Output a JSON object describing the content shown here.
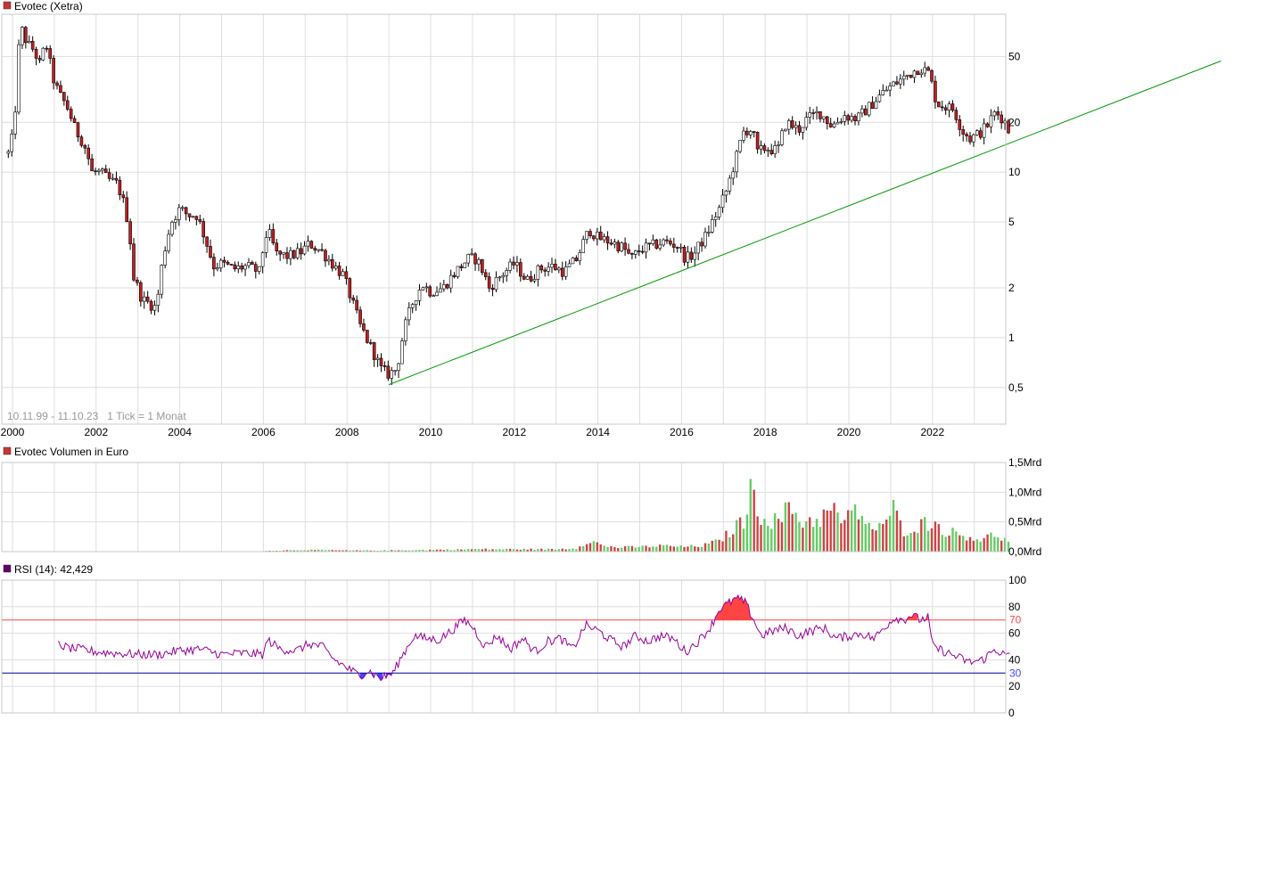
{
  "colors": {
    "up": "#00a000",
    "down": "#a00000",
    "up_body": "#ffffff",
    "down_body": "#c02020",
    "trendline": "#009900",
    "vol_up": "#66cc66",
    "vol_down": "#cc4444",
    "rsi_line": "#990099",
    "rsi_over": "#ff4444",
    "rsi_under": "#4444ff",
    "legend_price": "#cc3333",
    "legend_volume": "#cc3333",
    "legend_rsi": "#660066"
  },
  "chart_data": [
    {
      "type": "candlestick",
      "title": "Evotec (Xetra)",
      "subtitle": "10.11.99 - 11.10.23   1 Tick = 1 Monat",
      "scale": "log",
      "x_tick_labels": [
        "2000",
        "2002",
        "2004",
        "2006",
        "2008",
        "2010",
        "2012",
        "2014",
        "2016",
        "2018",
        "2020",
        "2022"
      ],
      "y_tick_labels": [
        "50",
        "20",
        "10",
        "5",
        "2",
        "1",
        "0,5"
      ],
      "y_ticks": [
        50,
        20,
        10,
        5,
        2,
        1,
        0.5
      ],
      "ylim": [
        0.3,
        90
      ],
      "x_range": [
        1999.9,
        2023.85
      ],
      "anchors": [
        [
          1999.9,
          13
        ],
        [
          2000.05,
          18
        ],
        [
          2000.2,
          75
        ],
        [
          2000.35,
          60
        ],
        [
          2000.5,
          55
        ],
        [
          2000.65,
          45
        ],
        [
          2000.8,
          60
        ],
        [
          2000.95,
          38
        ],
        [
          2001.1,
          30
        ],
        [
          2001.3,
          25
        ],
        [
          2001.5,
          18
        ],
        [
          2001.7,
          15
        ],
        [
          2001.9,
          10
        ],
        [
          2002.1,
          10
        ],
        [
          2002.3,
          9
        ],
        [
          2002.5,
          8.5
        ],
        [
          2002.7,
          6
        ],
        [
          2002.9,
          2.3
        ],
        [
          2003.1,
          1.7
        ],
        [
          2003.3,
          1.6
        ],
        [
          2003.45,
          1.5
        ],
        [
          2003.6,
          3
        ],
        [
          2003.8,
          5
        ],
        [
          2004.0,
          6
        ],
        [
          2004.2,
          5.5
        ],
        [
          2004.4,
          5.5
        ],
        [
          2004.6,
          4
        ],
        [
          2004.8,
          2.7
        ],
        [
          2005.0,
          2.8
        ],
        [
          2005.3,
          2.6
        ],
        [
          2005.6,
          2.7
        ],
        [
          2005.9,
          2.5
        ],
        [
          2006.1,
          4.5
        ],
        [
          2006.3,
          3.2
        ],
        [
          2006.6,
          3.1
        ],
        [
          2006.9,
          3.3
        ],
        [
          2007.1,
          3.7
        ],
        [
          2007.4,
          3.3
        ],
        [
          2007.7,
          2.7
        ],
        [
          2007.9,
          2.4
        ],
        [
          2008.1,
          1.7
        ],
        [
          2008.3,
          1.2
        ],
        [
          2008.5,
          0.95
        ],
        [
          2008.8,
          0.65
        ],
        [
          2009.0,
          0.6
        ],
        [
          2009.2,
          0.65
        ],
        [
          2009.4,
          1.2
        ],
        [
          2009.6,
          1.7
        ],
        [
          2009.8,
          2.1
        ],
        [
          2010.0,
          1.9
        ],
        [
          2010.3,
          2.0
        ],
        [
          2010.6,
          2.5
        ],
        [
          2010.9,
          3.0
        ],
        [
          2011.1,
          3.0
        ],
        [
          2011.4,
          2.0
        ],
        [
          2011.7,
          2.4
        ],
        [
          2012.0,
          2.8
        ],
        [
          2012.3,
          2.2
        ],
        [
          2012.6,
          2.6
        ],
        [
          2012.9,
          2.7
        ],
        [
          2013.2,
          2.5
        ],
        [
          2013.5,
          3.0
        ],
        [
          2013.8,
          4.5
        ],
        [
          2014.0,
          4.0
        ],
        [
          2014.3,
          3.8
        ],
        [
          2014.6,
          3.5
        ],
        [
          2014.8,
          3.0
        ],
        [
          2015.0,
          3.4
        ],
        [
          2015.3,
          3.6
        ],
        [
          2015.6,
          3.8
        ],
        [
          2015.9,
          3.6
        ],
        [
          2016.1,
          3.0
        ],
        [
          2016.3,
          3.2
        ],
        [
          2016.6,
          4.2
        ],
        [
          2016.9,
          6.0
        ],
        [
          2017.1,
          8.0
        ],
        [
          2017.3,
          12
        ],
        [
          2017.5,
          18
        ],
        [
          2017.7,
          18
        ],
        [
          2017.8,
          13
        ],
        [
          2018.0,
          14
        ],
        [
          2018.3,
          13.5
        ],
        [
          2018.5,
          20
        ],
        [
          2018.8,
          18
        ],
        [
          2019.0,
          21
        ],
        [
          2019.3,
          23
        ],
        [
          2019.6,
          19
        ],
        [
          2019.9,
          22
        ],
        [
          2020.2,
          21
        ],
        [
          2020.5,
          25
        ],
        [
          2020.8,
          30
        ],
        [
          2021.0,
          33
        ],
        [
          2021.3,
          37
        ],
        [
          2021.5,
          40
        ],
        [
          2021.7,
          43
        ],
        [
          2021.9,
          40
        ],
        [
          2022.1,
          26
        ],
        [
          2022.3,
          25
        ],
        [
          2022.5,
          24
        ],
        [
          2022.7,
          18
        ],
        [
          2022.9,
          16
        ],
        [
          2023.1,
          17
        ],
        [
          2023.3,
          19
        ],
        [
          2023.5,
          23
        ],
        [
          2023.7,
          21
        ],
        [
          2023.85,
          17
        ]
      ],
      "trendline": [
        [
          2009.0,
          0.52
        ],
        [
          2028.9,
          47
        ]
      ]
    },
    {
      "type": "bar",
      "title": "Evotec Volumen in Euro",
      "y_tick_labels": [
        "1,5Mrd",
        "1,0Mrd",
        "0,5Mrd",
        "0,0Mrd"
      ],
      "y_ticks": [
        1.5,
        1.0,
        0.5,
        0.0
      ],
      "ylim": [
        0,
        1.5
      ],
      "unit": "Mrd EUR",
      "data_start": 2005.9,
      "anchors": [
        [
          2005.9,
          0.01
        ],
        [
          2007.0,
          0.03
        ],
        [
          2008.0,
          0.02
        ],
        [
          2009.0,
          0.02
        ],
        [
          2010.0,
          0.03
        ],
        [
          2011.0,
          0.04
        ],
        [
          2012.0,
          0.04
        ],
        [
          2013.0,
          0.04
        ],
        [
          2013.5,
          0.06
        ],
        [
          2013.8,
          0.2
        ],
        [
          2014.1,
          0.1
        ],
        [
          2014.5,
          0.07
        ],
        [
          2015.0,
          0.08
        ],
        [
          2015.6,
          0.1
        ],
        [
          2016.0,
          0.08
        ],
        [
          2016.5,
          0.1
        ],
        [
          2016.9,
          0.18
        ],
        [
          2017.2,
          0.35
        ],
        [
          2017.5,
          0.55
        ],
        [
          2017.7,
          1.1
        ],
        [
          2017.9,
          0.6
        ],
        [
          2018.3,
          0.5
        ],
        [
          2018.6,
          0.75
        ],
        [
          2018.9,
          0.5
        ],
        [
          2019.3,
          0.55
        ],
        [
          2019.6,
          0.7
        ],
        [
          2019.9,
          0.5
        ],
        [
          2020.2,
          0.7
        ],
        [
          2020.6,
          0.35
        ],
        [
          2020.9,
          0.45
        ],
        [
          2021.0,
          0.8
        ],
        [
          2021.3,
          0.35
        ],
        [
          2021.7,
          0.45
        ],
        [
          2022.0,
          0.5
        ],
        [
          2022.3,
          0.35
        ],
        [
          2022.6,
          0.3
        ],
        [
          2022.9,
          0.25
        ],
        [
          2023.2,
          0.2
        ],
        [
          2023.5,
          0.3
        ],
        [
          2023.85,
          0.15
        ]
      ]
    },
    {
      "type": "line",
      "title": "RSI (14): 42,429",
      "y_tick_labels": [
        "100",
        "80",
        "60",
        "40",
        "20",
        "0"
      ],
      "y_ticks": [
        100,
        80,
        60,
        40,
        20,
        0
      ],
      "ylim": [
        0,
        100
      ],
      "overbought": 70,
      "oversold": 30,
      "overbought_label": "70",
      "oversold_label": "30",
      "data_start": 2001.1,
      "anchors": [
        [
          2001.1,
          52
        ],
        [
          2001.3,
          49
        ],
        [
          2001.6,
          48
        ],
        [
          2002.0,
          46
        ],
        [
          2002.5,
          45
        ],
        [
          2003.0,
          44
        ],
        [
          2003.5,
          44
        ],
        [
          2004.0,
          47
        ],
        [
          2004.5,
          48
        ],
        [
          2005.0,
          44
        ],
        [
          2005.5,
          45
        ],
        [
          2006.0,
          44
        ],
        [
          2006.1,
          55
        ],
        [
          2006.4,
          48
        ],
        [
          2006.8,
          47
        ],
        [
          2007.1,
          52
        ],
        [
          2007.4,
          50
        ],
        [
          2007.7,
          40
        ],
        [
          2008.0,
          34
        ],
        [
          2008.3,
          28
        ],
        [
          2008.5,
          32
        ],
        [
          2008.8,
          26
        ],
        [
          2009.1,
          30
        ],
        [
          2009.3,
          42
        ],
        [
          2009.6,
          58
        ],
        [
          2009.9,
          56
        ],
        [
          2010.2,
          55
        ],
        [
          2010.5,
          62
        ],
        [
          2010.8,
          70
        ],
        [
          2011.0,
          65
        ],
        [
          2011.3,
          50
        ],
        [
          2011.6,
          58
        ],
        [
          2011.9,
          48
        ],
        [
          2012.2,
          56
        ],
        [
          2012.5,
          46
        ],
        [
          2012.8,
          54
        ],
        [
          2013.1,
          56
        ],
        [
          2013.4,
          48
        ],
        [
          2013.7,
          66
        ],
        [
          2014.0,
          62
        ],
        [
          2014.3,
          55
        ],
        [
          2014.6,
          50
        ],
        [
          2014.9,
          58
        ],
        [
          2015.2,
          54
        ],
        [
          2015.5,
          58
        ],
        [
          2015.8,
          56
        ],
        [
          2016.1,
          46
        ],
        [
          2016.4,
          54
        ],
        [
          2016.7,
          65
        ],
        [
          2016.9,
          78
        ],
        [
          2017.1,
          82
        ],
        [
          2017.3,
          86
        ],
        [
          2017.5,
          84
        ],
        [
          2017.7,
          72
        ],
        [
          2017.9,
          58
        ],
        [
          2018.2,
          62
        ],
        [
          2018.5,
          64
        ],
        [
          2018.8,
          58
        ],
        [
          2019.1,
          62
        ],
        [
          2019.4,
          64
        ],
        [
          2019.7,
          56
        ],
        [
          2020.0,
          58
        ],
        [
          2020.3,
          60
        ],
        [
          2020.6,
          56
        ],
        [
          2020.9,
          66
        ],
        [
          2021.1,
          72
        ],
        [
          2021.3,
          70
        ],
        [
          2021.5,
          74
        ],
        [
          2021.7,
          70
        ],
        [
          2021.9,
          72
        ],
        [
          2022.0,
          50
        ],
        [
          2022.3,
          46
        ],
        [
          2022.6,
          42
        ],
        [
          2022.9,
          38
        ],
        [
          2023.2,
          40
        ],
        [
          2023.5,
          48
        ],
        [
          2023.7,
          44
        ],
        [
          2023.85,
          42.4
        ]
      ]
    }
  ]
}
